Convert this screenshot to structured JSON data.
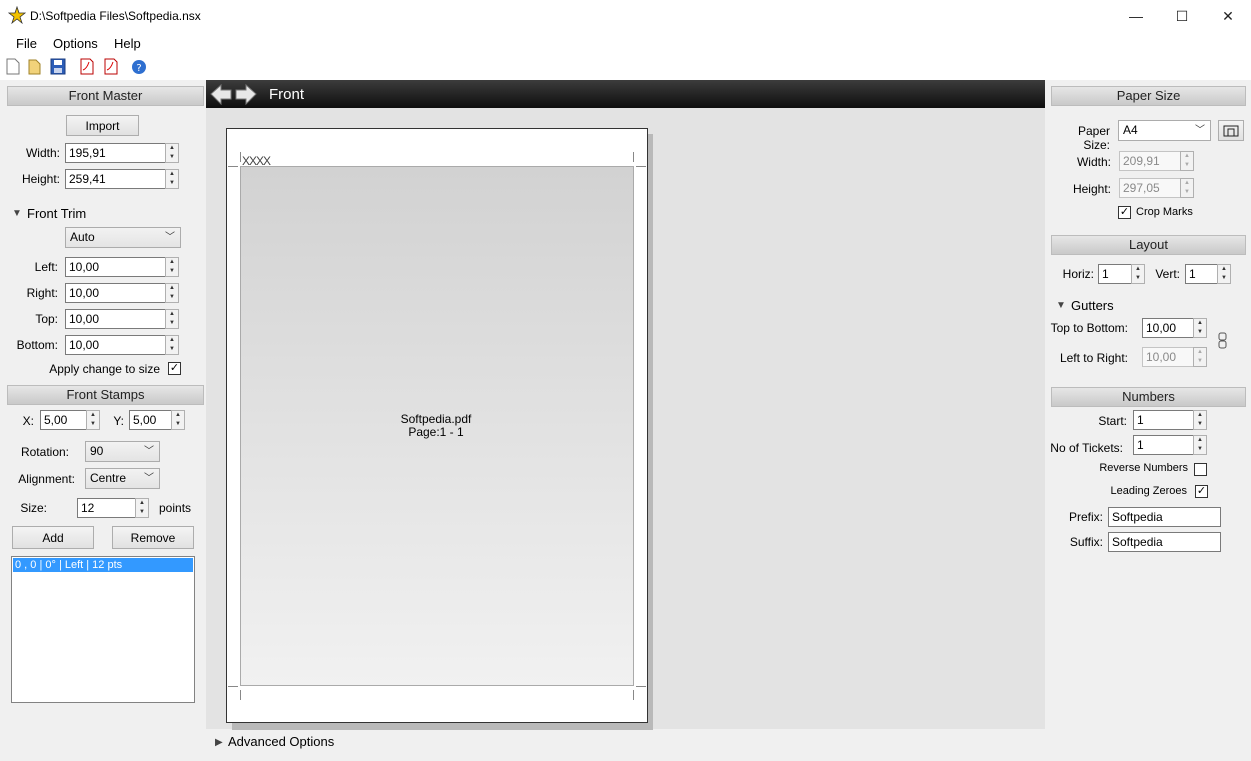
{
  "window": {
    "title": "D:\\Softpedia Files\\Softpedia.nsx",
    "minimize": "—",
    "maximize": "☐",
    "close": "✕"
  },
  "menu": [
    "File",
    "Options",
    "Help"
  ],
  "toolbar_icons": [
    "new-icon",
    "open-icon",
    "save-icon",
    "pdf-icon",
    "pdf-export-icon",
    "help-icon"
  ],
  "front_master": {
    "header": "Front Master",
    "import_label": "Import",
    "width_label": "Width:",
    "width_value": "195,91",
    "height_label": "Height:",
    "height_value": "259,41"
  },
  "front_trim": {
    "header": "Front Trim",
    "mode": "Auto",
    "left_label": "Left:",
    "left_value": "10,00",
    "right_label": "Right:",
    "right_value": "10,00",
    "top_label": "Top:",
    "top_value": "10,00",
    "bottom_label": "Bottom:",
    "bottom_value": "10,00",
    "apply_label": "Apply change to size",
    "apply_checked": true
  },
  "front_stamps": {
    "header": "Front Stamps",
    "x_label": "X:",
    "x_value": "5,00",
    "y_label": "Y:",
    "y_value": "5,00",
    "rotation_label": "Rotation:",
    "rotation_value": "90",
    "alignment_label": "Alignment:",
    "alignment_value": "Centre",
    "size_label": "Size:",
    "size_value": "12",
    "size_unit": "points",
    "add_label": "Add",
    "remove_label": "Remove",
    "list": [
      "0 , 0 | 0° | Left | 12 pts"
    ]
  },
  "canvas": {
    "nav_title": "Front",
    "stamp_marker": "XXXX",
    "file_name": "Softpedia.pdf",
    "page_info": "Page:1 - 1",
    "advanced_label": "Advanced Options"
  },
  "paper_size": {
    "header": "Paper Size",
    "size_label": "Paper Size:",
    "size_value": "A4",
    "width_label": "Width:",
    "width_value": "209,91",
    "height_label": "Height:",
    "height_value": "297,05",
    "crop_label": "Crop Marks",
    "crop_checked": true
  },
  "layout": {
    "header": "Layout",
    "horiz_label": "Horiz:",
    "horiz_value": "1",
    "vert_label": "Vert:",
    "vert_value": "1",
    "gutters_label": "Gutters",
    "ttb_label": "Top to Bottom:",
    "ttb_value": "10,00",
    "ltr_label": "Left to Right:",
    "ltr_value": "10,00"
  },
  "numbers": {
    "header": "Numbers",
    "start_label": "Start:",
    "start_value": "1",
    "tickets_label": "No of Tickets:",
    "tickets_value": "1",
    "reverse_label": "Reverse Numbers",
    "reverse_checked": false,
    "zeroes_label": "Leading Zeroes",
    "zeroes_checked": true,
    "prefix_label": "Prefix:",
    "prefix_value": "Softpedia",
    "suffix_label": "Suffix:",
    "suffix_value": "Softpedia"
  },
  "colors": {
    "selection": "#3399ff",
    "nav_bar": "#1a1a1a"
  }
}
